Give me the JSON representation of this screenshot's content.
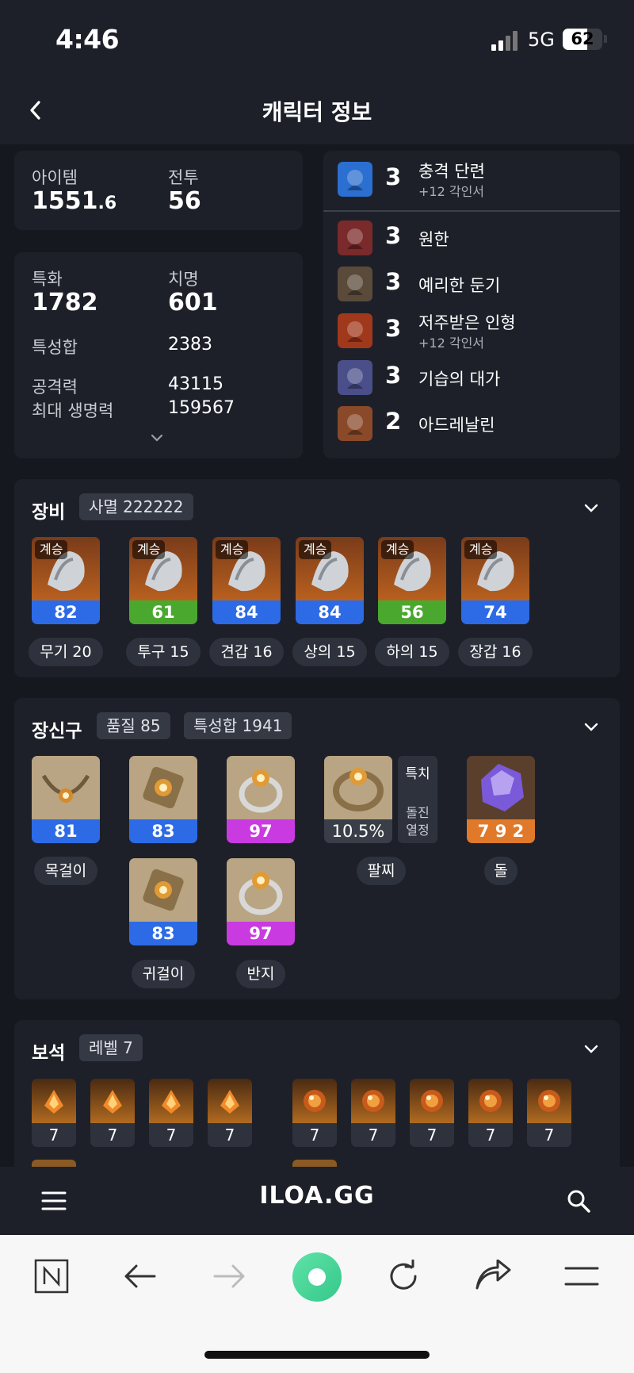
{
  "status": {
    "time": "4:46",
    "network": "5G",
    "battery": "62",
    "battery_level": 0.62
  },
  "header": {
    "title": "캐릭터 정보"
  },
  "stats": {
    "item_label": "아이템",
    "item_value_main": "1551",
    "item_value_dec": ".6",
    "combat_label": "전투",
    "combat_value": "56",
    "spec_label": "특화",
    "spec_value": "1782",
    "crit_label": "치명",
    "crit_value": "601",
    "total_label": "특성합",
    "total_value": "2383",
    "atk_label": "공격력",
    "atk_value": "43115",
    "hp_label": "최대 생명력",
    "hp_value": "159567"
  },
  "engravings": [
    {
      "level": "3",
      "name": "충격 단련",
      "sub": "+12 각인서",
      "icon": "shock-training-icon",
      "color": "#2b6fd0"
    },
    {
      "level": "3",
      "name": "원한",
      "sub": "",
      "icon": "grudge-icon",
      "color": "#7a2a2a"
    },
    {
      "level": "3",
      "name": "예리한 둔기",
      "sub": "",
      "icon": "keen-blunt-weapon-icon",
      "color": "#5a4a3a"
    },
    {
      "level": "3",
      "name": "저주받은 인형",
      "sub": "+12 각인서",
      "icon": "cursed-doll-icon",
      "color": "#a0381c"
    },
    {
      "level": "3",
      "name": "기습의 대가",
      "sub": "",
      "icon": "master-ambusher-icon",
      "color": "#4a4f8a"
    },
    {
      "level": "2",
      "name": "아드레날린",
      "sub": "",
      "icon": "adrenaline-icon",
      "color": "#8a4a2a"
    }
  ],
  "equipment": {
    "title": "장비",
    "tag": "사멸 222222",
    "items": [
      {
        "grade": "계승",
        "quality": "82",
        "qcolor": "#2d6be6",
        "label": "무기 20",
        "icon": "weapon-icon"
      },
      {
        "grade": "계승",
        "quality": "61",
        "qcolor": "#4aa82f",
        "label": "투구 15",
        "icon": "helmet-icon"
      },
      {
        "grade": "계승",
        "quality": "84",
        "qcolor": "#2d6be6",
        "label": "견갑 16",
        "icon": "shoulder-icon"
      },
      {
        "grade": "계승",
        "quality": "84",
        "qcolor": "#2d6be6",
        "label": "상의 15",
        "icon": "chest-icon"
      },
      {
        "grade": "계승",
        "quality": "56",
        "qcolor": "#4aa82f",
        "label": "하의 15",
        "icon": "pants-icon"
      },
      {
        "grade": "계승",
        "quality": "74",
        "qcolor": "#2d6be6",
        "label": "장갑 16",
        "icon": "gloves-icon"
      }
    ]
  },
  "accessories": {
    "title": "장신구",
    "tag1": "품질 85",
    "tag2": "특성합 1941",
    "necklace": {
      "quality": "81",
      "label": "목걸이"
    },
    "earring1": {
      "quality": "83"
    },
    "earring2": {
      "quality": "83"
    },
    "earring_label": "귀걸이",
    "ring1": {
      "quality": "97"
    },
    "ring2": {
      "quality": "97"
    },
    "ring_label": "반지",
    "bracelet": {
      "value": "10.5%",
      "label": "팔찌",
      "side1": "특치",
      "side2": "돌진",
      "side3": "열정"
    },
    "stone": {
      "value": "7 9 2",
      "label": "돌"
    }
  },
  "gems": {
    "title": "보석",
    "tag": "레벨 7",
    "levels": [
      "7",
      "7",
      "7",
      "7",
      "7",
      "7",
      "7",
      "7",
      "7"
    ]
  },
  "site": {
    "logo": "ILOA.GG"
  }
}
